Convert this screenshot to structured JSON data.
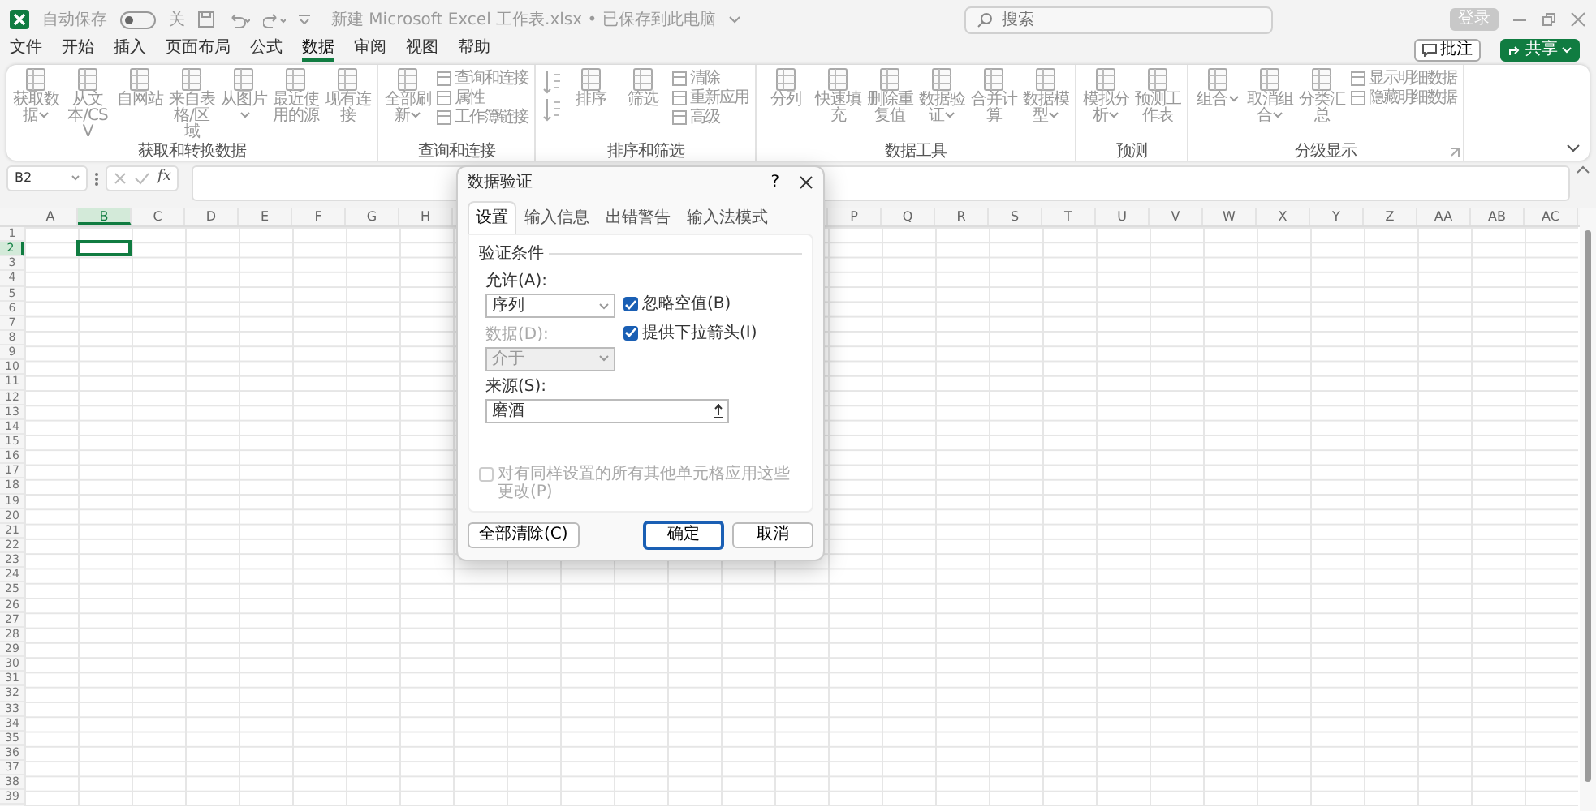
{
  "title_bar": {
    "autosave_label": "自动保存",
    "autosave_on": false,
    "autosave_state": "关",
    "document_title": "新建 Microsoft Excel 工作表.xlsx • 已保存到此电脑",
    "search_placeholder": "搜索",
    "sign_in": "登录"
  },
  "menu": {
    "tabs": [
      {
        "label": "文件",
        "selected": false
      },
      {
        "label": "开始",
        "selected": false
      },
      {
        "label": "插入",
        "selected": false
      },
      {
        "label": "页面布局",
        "selected": false
      },
      {
        "label": "公式",
        "selected": false
      },
      {
        "label": "数据",
        "selected": true
      },
      {
        "label": "审阅",
        "selected": false
      },
      {
        "label": "视图",
        "selected": false
      },
      {
        "label": "帮助",
        "selected": false
      }
    ],
    "comments": "批注",
    "share": "共享"
  },
  "ribbon": {
    "groups": [
      {
        "title": "获取和转换数据",
        "items": [
          {
            "kind": "large",
            "label": "获取数据",
            "dropdown": true
          },
          {
            "kind": "large",
            "label": "从文本/CSV"
          },
          {
            "kind": "large",
            "label": "自网站"
          },
          {
            "kind": "large",
            "label": "来自表格/区域"
          },
          {
            "kind": "large",
            "label": "从图片",
            "dropdown": true
          },
          {
            "kind": "large",
            "label": "最近使用的源"
          },
          {
            "kind": "large",
            "label": "现有连接"
          }
        ]
      },
      {
        "title": "查询和连接",
        "items": [
          {
            "kind": "large",
            "label": "全部刷新",
            "dropdown": true
          },
          {
            "kind": "small",
            "label": "查询和连接"
          },
          {
            "kind": "small",
            "label": "属性"
          },
          {
            "kind": "small",
            "label": "工作簿链接"
          }
        ]
      },
      {
        "title": "排序和筛选",
        "items": [
          {
            "kind": "icon"
          },
          {
            "kind": "icon"
          },
          {
            "kind": "large",
            "label": "排序"
          },
          {
            "kind": "large",
            "label": "筛选"
          },
          {
            "kind": "small",
            "label": "清除"
          },
          {
            "kind": "small",
            "label": "重新应用"
          },
          {
            "kind": "small",
            "label": "高级"
          }
        ]
      },
      {
        "title": "数据工具",
        "items": [
          {
            "kind": "large",
            "label": "分列"
          },
          {
            "kind": "large",
            "label": "快速填充"
          },
          {
            "kind": "large",
            "label": "删除重复值"
          },
          {
            "kind": "large",
            "label": "数据验证",
            "dropdown": true
          },
          {
            "kind": "large",
            "label": "合并计算"
          },
          {
            "kind": "large",
            "label": "数据模型",
            "dropdown": true
          }
        ]
      },
      {
        "title": "预测",
        "items": [
          {
            "kind": "large",
            "label": "模拟分析",
            "dropdown": true
          },
          {
            "kind": "large",
            "label": "预测工作表"
          }
        ]
      },
      {
        "title": "分级显示",
        "launcher": true,
        "items": [
          {
            "kind": "large",
            "label": "组合",
            "dropdown": true
          },
          {
            "kind": "large",
            "label": "取消组合",
            "dropdown": true
          },
          {
            "kind": "large",
            "label": "分类汇总"
          },
          {
            "kind": "small",
            "label": "显示明细数据"
          },
          {
            "kind": "small",
            "label": "隐藏明细数据"
          }
        ]
      }
    ]
  },
  "formula_bar": {
    "name_box": "B2",
    "function_label": "fx"
  },
  "sheet": {
    "column_groups": [
      [
        {
          "label": "A",
          "selected": false
        },
        {
          "label": "B",
          "selected": true
        },
        {
          "label": "C",
          "selected": false
        },
        {
          "label": "D",
          "selected": false
        },
        {
          "label": "E",
          "selected": false
        },
        {
          "label": "F",
          "selected": false
        },
        {
          "label": "G",
          "selected": false
        },
        {
          "label": "H",
          "selected": false
        }
      ],
      [
        {
          "label": "P",
          "selected": false
        },
        {
          "label": "Q",
          "selected": false
        },
        {
          "label": "R",
          "selected": false
        },
        {
          "label": "S",
          "selected": false
        },
        {
          "label": "T",
          "selected": false
        },
        {
          "label": "U",
          "selected": false
        },
        {
          "label": "V",
          "selected": false
        },
        {
          "label": "W",
          "selected": false
        },
        {
          "label": "X",
          "selected": false
        },
        {
          "label": "Y",
          "selected": false
        },
        {
          "label": "Z",
          "selected": false
        },
        {
          "label": "AA",
          "selected": false
        },
        {
          "label": "AB",
          "selected": false
        },
        {
          "label": "AC",
          "selected": false
        }
      ]
    ],
    "rows": [
      {
        "label": "1",
        "selected": false
      },
      {
        "label": "2",
        "selected": true
      },
      {
        "label": "3",
        "selected": false
      },
      {
        "label": "4",
        "selected": false
      },
      {
        "label": "5",
        "selected": false
      },
      {
        "label": "6",
        "selected": false
      },
      {
        "label": "7",
        "selected": false
      },
      {
        "label": "8",
        "selected": false
      },
      {
        "label": "9",
        "selected": false
      },
      {
        "label": "10",
        "selected": false
      },
      {
        "label": "11",
        "selected": false
      },
      {
        "label": "12",
        "selected": false
      },
      {
        "label": "13",
        "selected": false
      },
      {
        "label": "14",
        "selected": false
      },
      {
        "label": "15",
        "selected": false
      },
      {
        "label": "16",
        "selected": false
      },
      {
        "label": "17",
        "selected": false
      },
      {
        "label": "18",
        "selected": false
      },
      {
        "label": "19",
        "selected": false
      },
      {
        "label": "20",
        "selected": false
      },
      {
        "label": "21",
        "selected": false
      },
      {
        "label": "22",
        "selected": false
      },
      {
        "label": "23",
        "selected": false
      },
      {
        "label": "24",
        "selected": false
      },
      {
        "label": "25",
        "selected": false
      },
      {
        "label": "26",
        "selected": false
      },
      {
        "label": "27",
        "selected": false
      },
      {
        "label": "28",
        "selected": false
      },
      {
        "label": "29",
        "selected": false
      },
      {
        "label": "30",
        "selected": false
      },
      {
        "label": "31",
        "selected": false
      },
      {
        "label": "32",
        "selected": false
      },
      {
        "label": "33",
        "selected": false
      },
      {
        "label": "34",
        "selected": false
      },
      {
        "label": "35",
        "selected": false
      },
      {
        "label": "36",
        "selected": false
      },
      {
        "label": "37",
        "selected": false
      },
      {
        "label": "38",
        "selected": false
      },
      {
        "label": "39",
        "selected": false
      }
    ]
  },
  "dialog": {
    "title": "数据验证",
    "help": "?",
    "tabs": [
      {
        "label": "设置",
        "selected": true
      },
      {
        "label": "输入信息",
        "selected": false
      },
      {
        "label": "出错警告",
        "selected": false
      },
      {
        "label": "输入法模式",
        "selected": false
      }
    ],
    "section": "验证条件",
    "allow_label": "允许(A):",
    "allow_value": "序列",
    "data_label": "数据(D):",
    "data_value": "介于",
    "data_disabled": true,
    "checkboxes": [
      {
        "label": "忽略空值(B)",
        "checked": true
      },
      {
        "label": "提供下拉箭头(I)",
        "checked": true
      }
    ],
    "source_label": "来源(S):",
    "source_value": "磨酒",
    "apply_all": {
      "label": "对有同样设置的所有其他单元格应用这些更改(P)",
      "checked": false,
      "disabled": true
    },
    "clear_button": "全部清除(C)",
    "ok_button": "确定",
    "cancel_button": "取消"
  }
}
